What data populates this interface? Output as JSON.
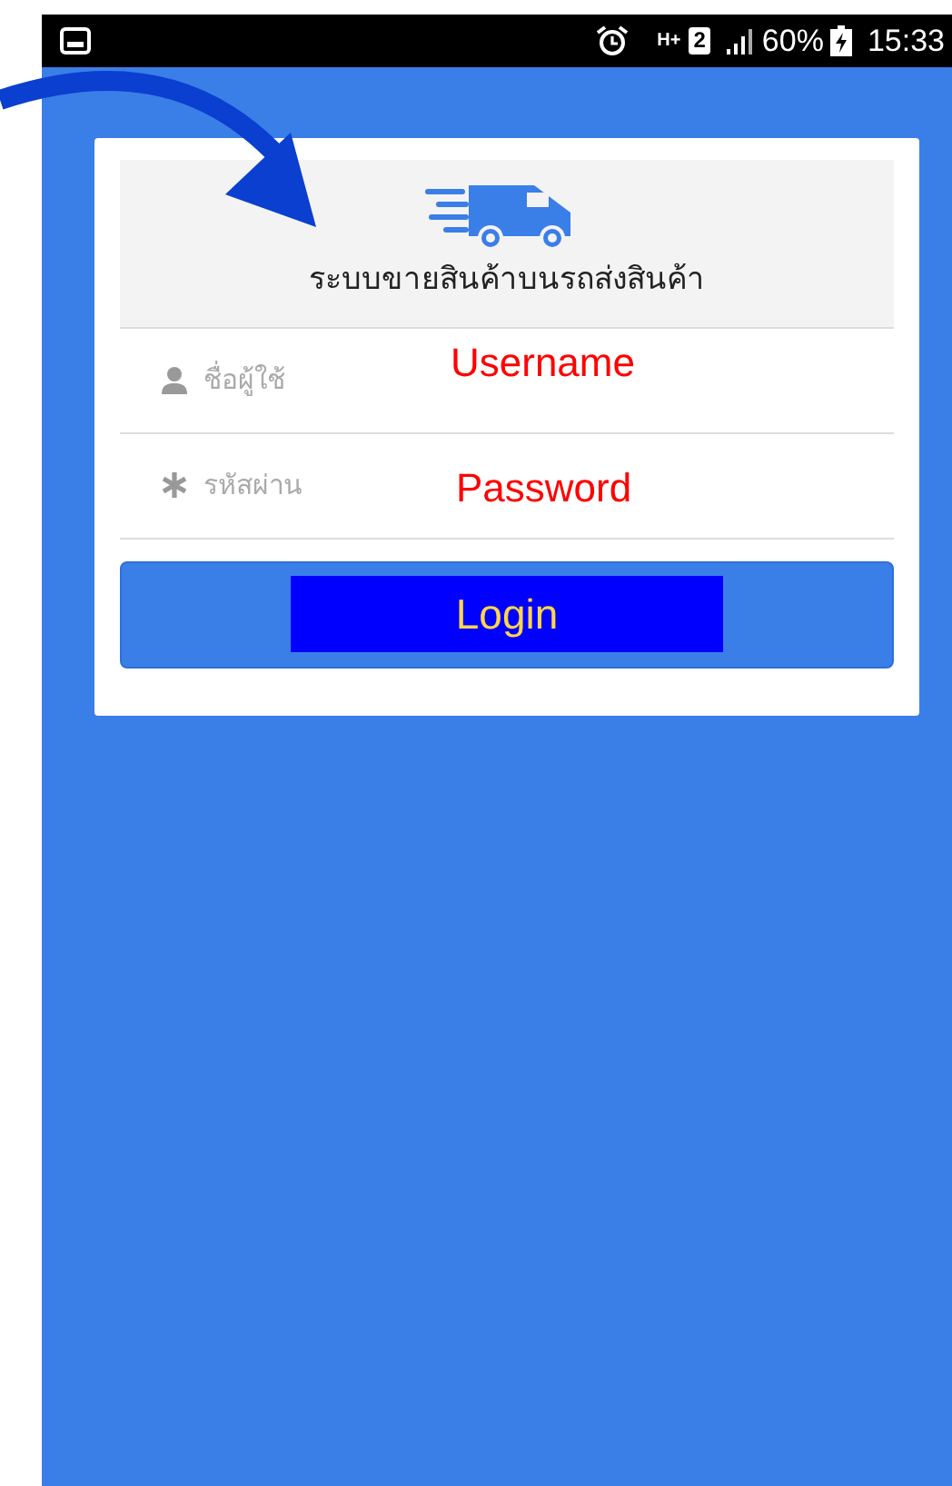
{
  "status_bar": {
    "network": "H+",
    "sim": "2",
    "battery": "60%",
    "time": "15:33"
  },
  "app": {
    "title": "ระบบขายสินค้าบนรถส่งสินค้า",
    "fields": [
      {
        "kind": "user",
        "placeholder": "ชื่อผู้ใช้"
      },
      {
        "kind": "password",
        "placeholder": "รหัสผ่าน"
      }
    ],
    "login_button": "Login"
  },
  "annotations": [
    {
      "text": "Username"
    },
    {
      "text": "Password"
    }
  ]
}
